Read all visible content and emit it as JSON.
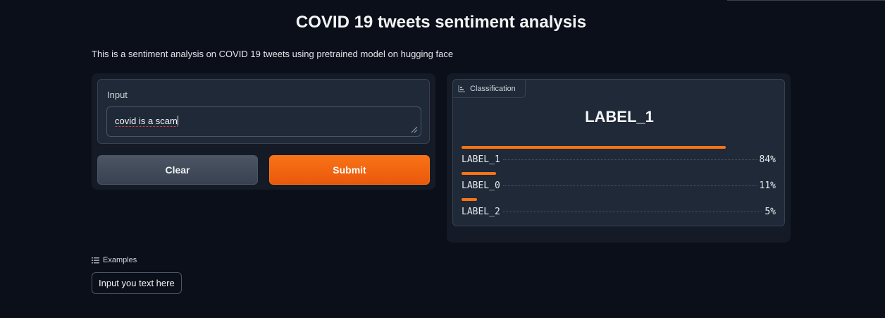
{
  "app": {
    "title": "COVID 19 tweets sentiment analysis",
    "description": "This is a sentiment analysis on COVID 19 tweets using pretrained model on hugging face"
  },
  "input": {
    "label": "Input",
    "value": "covid is a scam"
  },
  "buttons": {
    "clear": "Clear",
    "submit": "Submit"
  },
  "output": {
    "tab_label": "Classification",
    "top_label": "LABEL_1",
    "confidences": [
      {
        "label": "LABEL_1",
        "percent_text": "84%",
        "value": 0.84
      },
      {
        "label": "LABEL_0",
        "percent_text": "11%",
        "value": 0.11
      },
      {
        "label": "LABEL_2",
        "percent_text": "5%",
        "value": 0.05
      }
    ]
  },
  "examples": {
    "label": "Examples",
    "items": [
      "Input you text here"
    ]
  },
  "colors": {
    "accent": "#f97316",
    "background": "#0b0f19",
    "panel": "#1f2937"
  }
}
